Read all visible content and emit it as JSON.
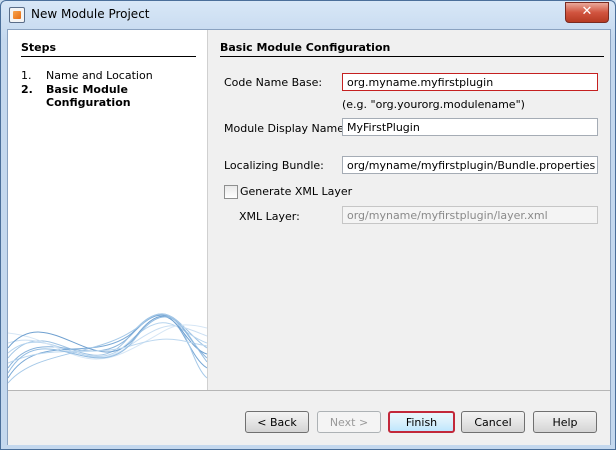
{
  "window": {
    "title": "New Module Project",
    "close_label": "✕"
  },
  "steps": {
    "title": "Steps",
    "items": [
      {
        "num": "1.",
        "label": "Name and Location",
        "current": false
      },
      {
        "num": "2.",
        "label": "Basic Module Configuration",
        "current": true
      }
    ]
  },
  "main": {
    "title": "Basic Module Configuration",
    "code_name_base": {
      "label": "Code Name Base:",
      "value": "org.myname.myfirstplugin",
      "hint": "(e.g. \"org.yourorg.modulename\")"
    },
    "display_name": {
      "label": "Module Display Name:",
      "value": "MyFirstPlugin"
    },
    "localizing_bundle": {
      "label": "Localizing Bundle:",
      "value": "org/myname/myfirstplugin/Bundle.properties"
    },
    "generate_xml": {
      "label": "Generate XML Layer",
      "checked": false
    },
    "xml_layer": {
      "label": "XML Layer:",
      "value": "org/myname/myfirstplugin/layer.xml"
    }
  },
  "buttons": {
    "back": "< Back",
    "next": "Next >",
    "finish": "Finish",
    "cancel": "Cancel",
    "help": "Help"
  },
  "colors": {
    "accent": "#c2283a",
    "panel": "#ffffff",
    "chrome": "#c4d8ee"
  }
}
